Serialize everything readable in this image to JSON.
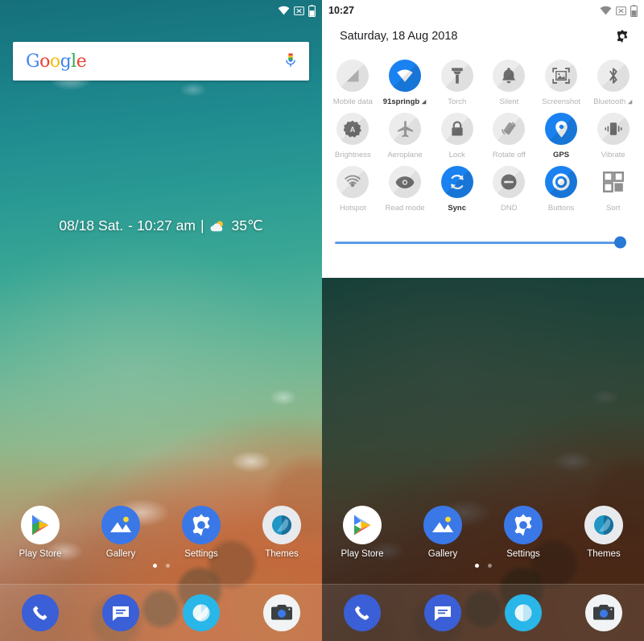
{
  "left_panel": {
    "status_bar": {
      "icons": [
        "wifi-icon",
        "no-sim-icon",
        "battery-icon"
      ]
    },
    "search": {
      "logo_text": "Google",
      "logo_letters": [
        "G",
        "o",
        "o",
        "g",
        "l",
        "e"
      ],
      "mic_icon": "microphone-icon"
    },
    "widget": {
      "date": "08/18",
      "day": "Sat.",
      "dash": "-",
      "time": "10:27",
      "meridiem": "am",
      "separator": "|",
      "weather_icon": "partly-cloudy-icon",
      "temperature": "35℃"
    },
    "apps": [
      {
        "label": "Play Store",
        "icon": "play-store-icon"
      },
      {
        "label": "Gallery",
        "icon": "gallery-icon"
      },
      {
        "label": "Settings",
        "icon": "settings-gear-icon"
      },
      {
        "label": "Themes",
        "icon": "themes-icon"
      }
    ],
    "page_dots": {
      "count": 2,
      "active_index": 0
    },
    "dock": [
      {
        "name": "Phone",
        "icon": "phone-icon"
      },
      {
        "name": "Messages",
        "icon": "messages-icon"
      },
      {
        "name": "Browser",
        "icon": "browser-icon"
      },
      {
        "name": "Camera",
        "icon": "camera-icon"
      }
    ]
  },
  "right_panel": {
    "status_bar": {
      "time": "10:27",
      "icons": [
        "wifi-icon",
        "no-sim-icon",
        "battery-icon"
      ]
    },
    "header": {
      "date": "Saturday, 18 Aug 2018",
      "settings_icon": "gear-icon"
    },
    "tiles": [
      [
        {
          "label": "Mobile data",
          "icon": "mobile-data-icon",
          "state": "off"
        },
        {
          "label": "91springb",
          "icon": "wifi-icon",
          "state": "on",
          "has_signal_indicator": true
        },
        {
          "label": "Torch",
          "icon": "flashlight-icon",
          "state": "off"
        },
        {
          "label": "Silent",
          "icon": "bell-icon",
          "state": "off"
        },
        {
          "label": "Screenshot",
          "icon": "screenshot-icon",
          "state": "off"
        },
        {
          "label": "Bluetooth",
          "icon": "bluetooth-icon",
          "state": "off",
          "has_signal_indicator": true
        }
      ],
      [
        {
          "label": "Brightness",
          "icon": "auto-brightness-icon",
          "state": "off"
        },
        {
          "label": "Aeroplane",
          "icon": "airplane-icon",
          "state": "off"
        },
        {
          "label": "Lock",
          "icon": "lock-icon",
          "state": "off"
        },
        {
          "label": "Rotate off",
          "icon": "rotate-icon",
          "state": "off"
        },
        {
          "label": "GPS",
          "icon": "location-pin-icon",
          "state": "on"
        },
        {
          "label": "Vibrate",
          "icon": "vibrate-icon",
          "state": "off"
        }
      ],
      [
        {
          "label": "Hotspot",
          "icon": "hotspot-icon",
          "state": "off"
        },
        {
          "label": "Read mode",
          "icon": "eye-icon",
          "state": "off"
        },
        {
          "label": "Sync",
          "icon": "sync-icon",
          "state": "on"
        },
        {
          "label": "DND",
          "icon": "do-not-disturb-icon",
          "state": "off"
        },
        {
          "label": "Buttons",
          "icon": "buttons-icon",
          "state": "on"
        },
        {
          "label": "Sort",
          "icon": "sort-grid-icon",
          "state": "plain"
        }
      ]
    ],
    "brightness_slider": {
      "value_percent": 98,
      "label": "brightness-slider"
    }
  },
  "colors": {
    "accent_blue": "#1a82f0",
    "slider_track": "#5b9bea",
    "slider_thumb": "#2979d6",
    "tile_off_bg": "#ececec",
    "tile_label": "#b3b3b3",
    "tile_label_active": "#333333",
    "sheet_bg": "#ffffff"
  }
}
